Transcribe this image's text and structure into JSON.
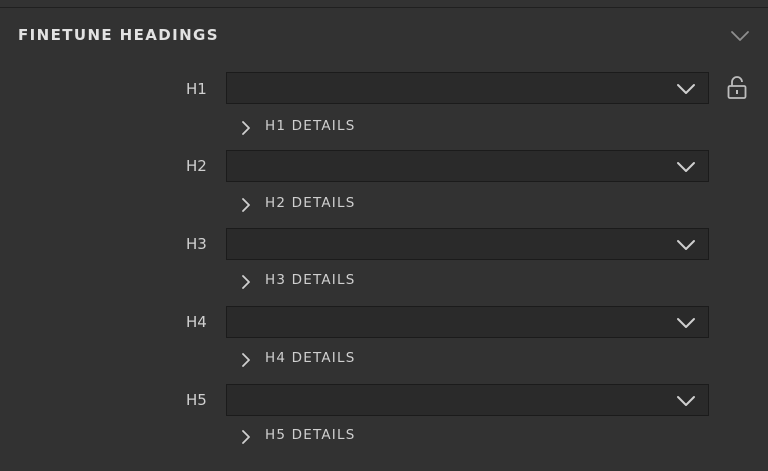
{
  "section": {
    "title": "FINETUNE HEADINGS",
    "collapse_icon": "chevron-down-icon"
  },
  "headings": [
    {
      "label": "H1",
      "value": "",
      "details_label": "H1 DETAILS"
    },
    {
      "label": "H2",
      "value": "",
      "details_label": "H2 DETAILS"
    },
    {
      "label": "H3",
      "value": "",
      "details_label": "H3 DETAILS"
    },
    {
      "label": "H4",
      "value": "",
      "details_label": "H4 DETAILS"
    },
    {
      "label": "H5",
      "value": "",
      "details_label": "H5 DETAILS"
    }
  ],
  "lock_icon": "unlocked-padlock-icon",
  "colors": {
    "background": "#323232",
    "select_background": "#2a2a2a",
    "text": "#d6d6d6",
    "icon": "#bdbdbd"
  }
}
